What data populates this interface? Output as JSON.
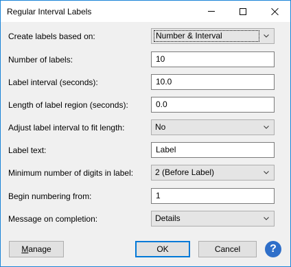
{
  "window": {
    "title": "Regular Interval Labels"
  },
  "form": {
    "rows": [
      {
        "label": "Create labels based on:",
        "type": "select",
        "value": "Number & Interval"
      },
      {
        "label": "Number of labels:",
        "type": "text",
        "value": "10"
      },
      {
        "label": "Label interval (seconds):",
        "type": "text",
        "value": "10.0"
      },
      {
        "label": "Length of label region (seconds):",
        "type": "text",
        "value": "0.0"
      },
      {
        "label": "Adjust label interval to fit length:",
        "type": "select",
        "value": "No"
      },
      {
        "label": "Label text:",
        "type": "text",
        "value": "Label"
      },
      {
        "label": "Minimum number of digits in label:",
        "type": "select",
        "value": "2 (Before Label)"
      },
      {
        "label": "Begin numbering from:",
        "type": "text",
        "value": "1"
      },
      {
        "label": "Message on completion:",
        "type": "select",
        "value": "Details"
      }
    ]
  },
  "buttons": {
    "manage_first": "M",
    "manage_rest": "anage",
    "ok": "OK",
    "cancel": "Cancel",
    "help": "?"
  },
  "colors": {
    "accent": "#0078d7",
    "window_border": "#1883d7",
    "help_icon": "#2f6fc9",
    "dialog_bg": "#f0f0f0"
  },
  "icons": [
    "minimize-icon",
    "maximize-icon",
    "close-icon",
    "chevron-down-icon",
    "help-icon"
  ]
}
